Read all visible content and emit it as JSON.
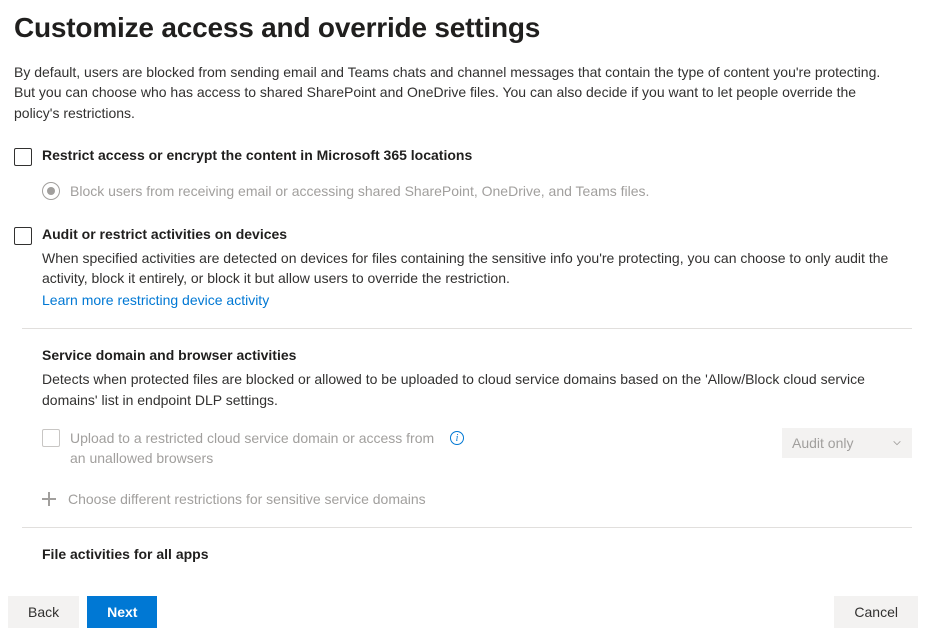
{
  "page": {
    "title": "Customize access and override settings",
    "intro": "By default, users are blocked from sending email and Teams chats and channel messages that contain the type of content you're protecting. But you can choose who has access to shared SharePoint and OneDrive files. You can also decide if you want to let people override the policy's restrictions."
  },
  "restrict": {
    "label": "Restrict access or encrypt the content in Microsoft 365 locations",
    "radio_block": "Block users from receiving email or accessing shared SharePoint, OneDrive, and Teams files."
  },
  "audit": {
    "label": "Audit or restrict activities on devices",
    "desc": "When specified activities are detected on devices for files containing the sensitive info you're protecting, you can choose to only audit the activity, block it entirely, or block it but allow users to override the restriction.",
    "learn_more": "Learn more restricting device activity"
  },
  "service": {
    "title": "Service domain and browser activities",
    "desc": "Detects when protected files are blocked or allowed to be uploaded to cloud service domains based on the 'Allow/Block cloud service domains' list in endpoint DLP settings.",
    "upload_label": "Upload to a restricted cloud service domain or access from an unallowed browsers",
    "dropdown_value": "Audit only",
    "choose_label": "Choose different restrictions for sensitive service domains"
  },
  "file_activities": {
    "title": "File activities for all apps"
  },
  "footer": {
    "back": "Back",
    "next": "Next",
    "cancel": "Cancel"
  }
}
